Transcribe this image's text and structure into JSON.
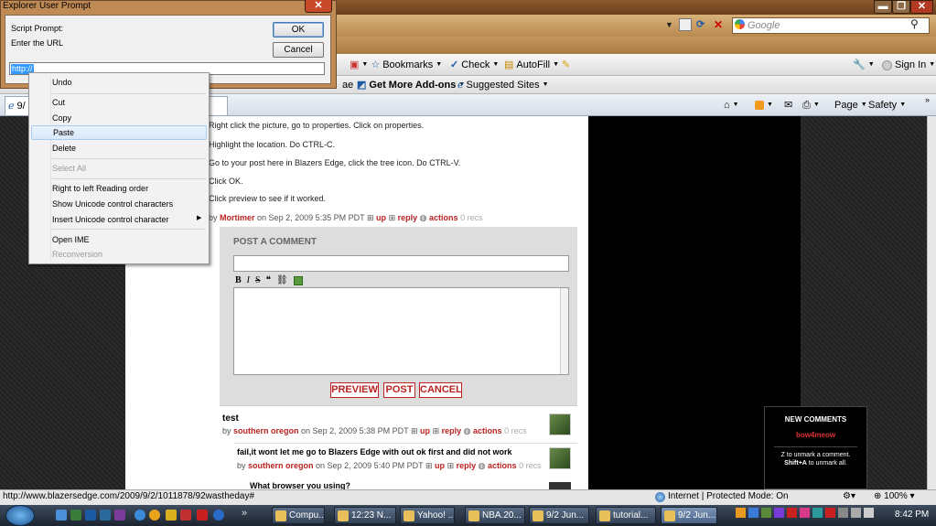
{
  "browser": {
    "search_placeholder": "Google",
    "command_bar": {
      "bookmarks": "Bookmarks",
      "check": "Check",
      "autofill": "AutoFill",
      "signin": "Sign In"
    },
    "favorites_bar": {
      "partial": "ae",
      "addons": "Get More Add-ons",
      "suggested": "Suggested Sites"
    },
    "tab_partial": "9/",
    "toolbar": {
      "page": "Page",
      "safety": "Safety"
    }
  },
  "post": {
    "lines": [
      "Right click the picture, go to properties. Click on properties.",
      "Highlight the location. Do CTRL-C.",
      "Go to your post here in Blazers Edge, click the tree icon. Do CTRL-V.",
      "Click OK.",
      "Click preview to see if it worked."
    ],
    "author": "Mortimer",
    "date": "on Sep 2, 2009 5:35 PM PDT",
    "up": "up",
    "reply": "reply",
    "actions": "actions",
    "recs": "0 recs"
  },
  "comment_form": {
    "title": "POST A COMMENT",
    "toolbar": [
      "B",
      "I",
      "S"
    ],
    "preview": "PREVIEW",
    "post": "POST",
    "cancel": "CANCEL"
  },
  "comments": [
    {
      "title": "test",
      "by": "by",
      "author": "southern oregon",
      "date": "on Sep 2, 2009 5:38 PM PDT",
      "up": "up",
      "reply": "reply",
      "actions": "actions",
      "recs": "0 recs"
    },
    {
      "title": "fail,it wont let me go to Blazers Edge with out ok first and did not work",
      "by": "by",
      "author": "southern oregon",
      "date": "on Sep 2, 2009 5:40 PM PDT",
      "up": "up",
      "reply": "reply",
      "actions": "actions",
      "recs": "0 recs"
    },
    {
      "title": "What browser you using?"
    }
  ],
  "new_comments": {
    "title": "NEW COMMENTS",
    "user": "bow4meow",
    "hint1": "Z to unmark a comment.",
    "hint2_key": "Shift+A",
    "hint2": " to unmark all."
  },
  "status": {
    "url": "http://www.blazersedge.com/2009/9/2/1011878/92wastheday#",
    "zone": "Internet | Protected Mode: On",
    "zoom": "100%"
  },
  "taskbar": {
    "buttons": [
      "Compu...",
      "12:23 N...",
      "Yahoo! ...",
      "NBA.20...",
      "9/2 Jun...",
      "tutorial...",
      "9/2 Jun..."
    ],
    "clock": "8:42 PM"
  },
  "dialog": {
    "title": "Explorer User Prompt",
    "script_label": "Script Prompt:",
    "message": "Enter the URL",
    "ok": "OK",
    "cancel": "Cancel",
    "input_value": "http://"
  },
  "context_menu": {
    "items": [
      "Undo",
      "Cut",
      "Copy",
      "Paste",
      "Delete",
      "Select All",
      "Right to left Reading order",
      "Show Unicode control characters",
      "Insert Unicode control character",
      "Open IME",
      "Reconversion"
    ]
  },
  "colors": {
    "accent_red": "#b22222",
    "titlebar": "#6a3f1b"
  }
}
